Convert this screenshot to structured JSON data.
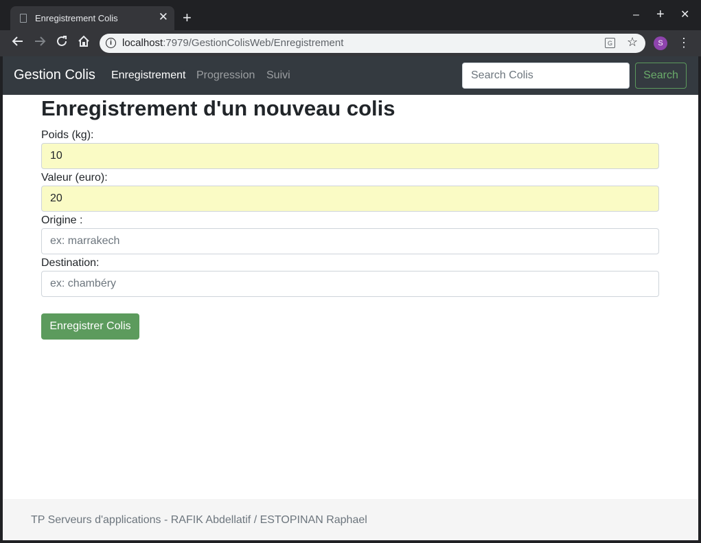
{
  "browser": {
    "tab_title": "Enregistrement Colis",
    "tab_close": "✕",
    "new_tab": "+",
    "window_controls": {
      "minimize": "–",
      "maximize": "+",
      "close": "✕"
    },
    "url_host": "localhost",
    "url_rest": ":7979/GestionColisWeb/Enregistrement",
    "profile_initial": "S",
    "icons": [
      "back-icon",
      "forward-icon",
      "reload-icon",
      "home-icon",
      "info-icon",
      "translate-icon",
      "star-icon",
      "menu-icon"
    ]
  },
  "navbar": {
    "brand": "Gestion Colis",
    "links": [
      {
        "label": "Enregistrement",
        "active": true
      },
      {
        "label": "Progression",
        "active": false
      },
      {
        "label": "Suivi",
        "active": false
      }
    ],
    "search_placeholder": "Search Colis",
    "search_button": "Search"
  },
  "form": {
    "heading": "Enregistrement d'un nouveau colis",
    "fields": [
      {
        "label": "Poids (kg):",
        "value": "10",
        "placeholder": ""
      },
      {
        "label": "Valeur (euro):",
        "value": "20",
        "placeholder": ""
      },
      {
        "label": "Origine :",
        "value": "",
        "placeholder": "ex: marrakech"
      },
      {
        "label": "Destination:",
        "value": "",
        "placeholder": "ex: chambéry"
      }
    ],
    "submit_label": "Enregistrer Colis"
  },
  "footer": {
    "text": "TP Serveurs d'applications - RAFIK Abdellatif / ESTOPINAN Raphael"
  },
  "colors": {
    "navbar_bg": "#343a40",
    "success_green": "#5c9b5d",
    "autofill_yellow": "#fafbc5"
  }
}
